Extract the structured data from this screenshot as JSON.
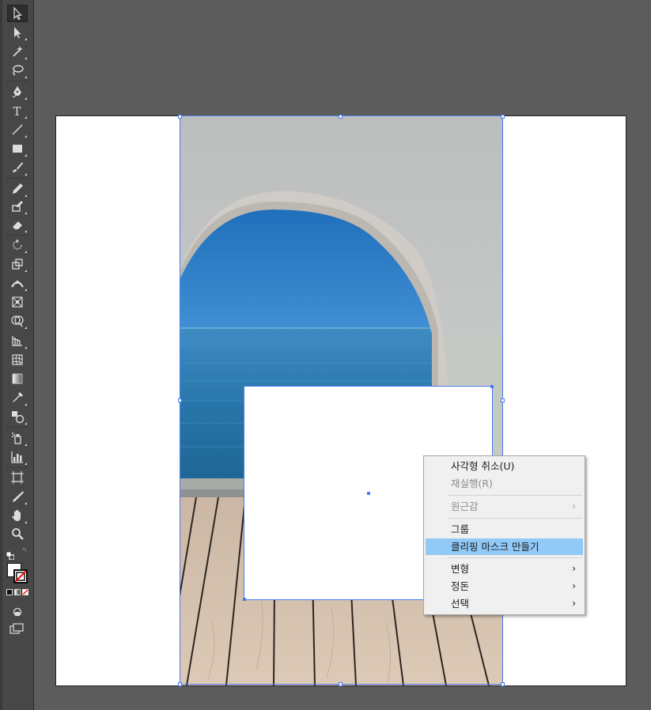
{
  "colors": {
    "canvas": "#5c5c5c",
    "toolbar": "#474747",
    "selection": "#4a7bf0",
    "menu_highlight": "#91c9f7",
    "fill_swatch": "#ffffff",
    "stroke_swatch": "#ff0000"
  },
  "toolbar": {
    "tools": [
      {
        "name": "selection-tool-icon"
      },
      {
        "name": "direct-selection-tool-icon"
      },
      {
        "name": "magic-wand-tool-icon"
      },
      {
        "name": "lasso-tool-icon"
      },
      {
        "name": "pen-tool-icon"
      },
      {
        "name": "type-tool-icon",
        "glyph": "T"
      },
      {
        "name": "line-tool-icon"
      },
      {
        "name": "rectangle-tool-icon"
      },
      {
        "name": "paintbrush-tool-icon"
      },
      {
        "name": "pencil-tool-icon"
      },
      {
        "name": "shaper-tool-icon"
      },
      {
        "name": "eraser-tool-icon"
      },
      {
        "name": "rotate-tool-icon"
      },
      {
        "name": "scale-tool-icon"
      },
      {
        "name": "width-tool-icon"
      },
      {
        "name": "free-transform-tool-icon"
      },
      {
        "name": "shape-builder-tool-icon"
      },
      {
        "name": "perspective-grid-tool-icon"
      },
      {
        "name": "mesh-tool-icon"
      },
      {
        "name": "gradient-tool-icon"
      },
      {
        "name": "eyedropper-tool-icon"
      },
      {
        "name": "blend-tool-icon"
      },
      {
        "name": "symbol-sprayer-tool-icon"
      },
      {
        "name": "column-graph-tool-icon"
      },
      {
        "name": "artboard-tool-icon"
      },
      {
        "name": "slice-tool-icon"
      },
      {
        "name": "hand-tool-icon"
      },
      {
        "name": "zoom-tool-icon"
      }
    ]
  },
  "context_menu": {
    "items": [
      {
        "label": "사각형 취소(U)",
        "enabled": true,
        "submenu": false
      },
      {
        "label": "재실행(R)",
        "enabled": false,
        "submenu": false
      },
      {
        "label": "원근감",
        "enabled": false,
        "submenu": true
      },
      {
        "label": "그룹",
        "enabled": true,
        "submenu": false
      },
      {
        "label": "클리핑 마스크 만들기",
        "enabled": true,
        "submenu": false,
        "highlighted": true
      },
      {
        "label": "변형",
        "enabled": true,
        "submenu": true
      },
      {
        "label": "정돈",
        "enabled": true,
        "submenu": true
      },
      {
        "label": "선택",
        "enabled": true,
        "submenu": true
      }
    ],
    "submenu_arrow": "›"
  }
}
